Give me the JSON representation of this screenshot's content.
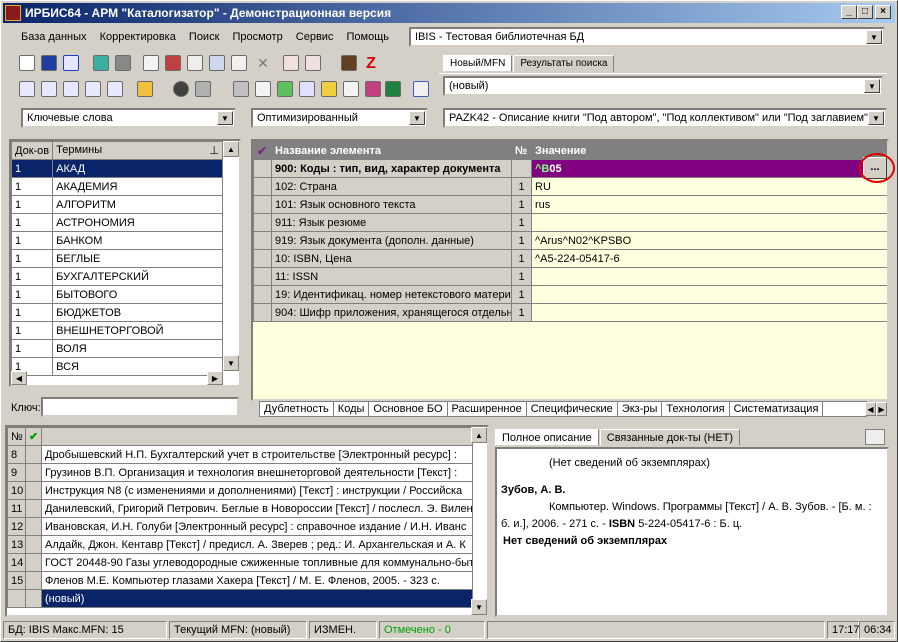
{
  "window": {
    "title": "ИРБИС64 - АРМ \"Каталогизатор\" - Демонстрационная версия",
    "buttons": [
      "_",
      "□",
      "×"
    ]
  },
  "menu": [
    "База данных",
    "Корректировка",
    "Поиск",
    "Просмотр",
    "Сервис",
    "Помощь"
  ],
  "db_select": "IBIS - Тестовая библиотечная БД",
  "record_tabs": [
    "Новый/MFN",
    "Результаты поиска"
  ],
  "new_record": "(новый)",
  "dict_select": "Ключевые слова",
  "mode_select": "Оптимизированный",
  "worksheet_select": "PAZK42 - Описание книги \"Под автором\", \"Под коллективом\" или \"Под заглавием\"",
  "terms": {
    "headers": [
      "Док-ов",
      "Термины"
    ],
    "rows": [
      {
        "count": "1",
        "term": "АКАД"
      },
      {
        "count": "1",
        "term": "АКАДЕМИЯ"
      },
      {
        "count": "1",
        "term": "АЛГОРИТМ"
      },
      {
        "count": "1",
        "term": "АСТРОНОМИЯ"
      },
      {
        "count": "1",
        "term": "БАНКОМ"
      },
      {
        "count": "1",
        "term": "БЕГЛЫЕ"
      },
      {
        "count": "1",
        "term": "БУХГАЛТЕРСКИЙ"
      },
      {
        "count": "1",
        "term": "БЫТОВОГО"
      },
      {
        "count": "1",
        "term": "БЮДЖЕТОВ"
      },
      {
        "count": "1",
        "term": "ВНЕШНЕТОРГОВОЙ"
      },
      {
        "count": "1",
        "term": "ВОЛЯ"
      },
      {
        "count": "1",
        "term": "ВСЯ"
      }
    ]
  },
  "key_label": "Ключ:",
  "fields": {
    "headers": [
      "Название элемента",
      "№",
      "Значение"
    ],
    "rows": [
      {
        "name": "900: Коды : тип, вид, характер документа",
        "n": "",
        "value": "^B05"
      },
      {
        "name": "102: Страна",
        "n": "1",
        "value": "RU"
      },
      {
        "name": "101: Язык основного текста",
        "n": "1",
        "value": "rus"
      },
      {
        "name": "911: Язык резюме",
        "n": "1",
        "value": ""
      },
      {
        "name": "919: Язык документа (дополн. данные)",
        "n": "1",
        "value": "^Arus^N02^KPSBO"
      },
      {
        "name": "10: ISBN, Цена",
        "n": "1",
        "value": "^A5-224-05417-6"
      },
      {
        "name": "11: ISSN",
        "n": "1",
        "value": ""
      },
      {
        "name": "19: Идентификац. номер нетекстового матери",
        "n": "1",
        "value": ""
      },
      {
        "name": "904: Шифр приложения, хранящегося отдельно",
        "n": "1",
        "value": ""
      }
    ],
    "edit_button": "..."
  },
  "bottom_tabs": [
    "Дублетность",
    "Коды",
    "Основное БО",
    "Расширенное",
    "Специфические",
    "Экз-ры",
    "Технология",
    "Систематизация"
  ],
  "docs": {
    "headers": [
      "№"
    ],
    "rows": [
      {
        "n": "8",
        "text": "Дробышевский Н.П. Бухгалтерский учет в строительстве [Электронный ресурс] :"
      },
      {
        "n": "9",
        "text": "Грузинов В.П. Организация и технология внешнеторговой деятельности [Текст] :"
      },
      {
        "n": "10",
        "text": "Инструкция N8  (с изменениями и дополнениями) [Текст] : инструкции / Российска"
      },
      {
        "n": "11",
        "text": "Данилевский, Григорий Петрович. Беглые в Новороссии [Текст] / послесл. Э. Вилен"
      },
      {
        "n": "12",
        "text": "Ивановская, И.Н. Голуби [Электронный ресурс] : справочное издание / И.Н. Иванс"
      },
      {
        "n": "13",
        "text": "Алдайк, Джон. Кентавр [Текст] / предисл. А. Зверев ; ред.: И. Архангельская и А. К"
      },
      {
        "n": "14",
        "text": "ГОСТ 20448-90 Газы углеводородные сжиженные топливные для коммунально-быт"
      },
      {
        "n": "15",
        "text": "Фленов М.Е. Компьютер глазами Хакера [Текст] / М. Е. Фленов, 2005. - 323 с."
      },
      {
        "n": "",
        "text": "(новый)"
      }
    ]
  },
  "desc_tabs": [
    "Полное описание",
    "Связанные док-ты (НЕТ)"
  ],
  "description": {
    "line1": "(Нет сведений об экземплярах)",
    "author": "Зубов, А. В.",
    "body1": "Компьютер. Windows. Программы [Текст] / А. В. Зубов. - [Б. м. :",
    "body2": "б. и.], 2006. - 271 с. -",
    "isbn_label": "ISBN",
    "body3": "5-224-05417-6 : Б. ц.",
    "footer": "Нет сведений об экземплярах"
  },
  "status": {
    "db": "БД: IBIS Макс.MFN: 15",
    "current": "Текущий MFN: (новый)",
    "changed": "ИЗМЕН.",
    "marked": "Отмечено - 0",
    "time1": "17:17",
    "time2": "06:34"
  },
  "colors": {
    "title": "#0a246a",
    "selected_row": "#800080",
    "field_bg": "#ffffe0",
    "marked_green": "#00a000",
    "highlight_red": "#e00000"
  }
}
